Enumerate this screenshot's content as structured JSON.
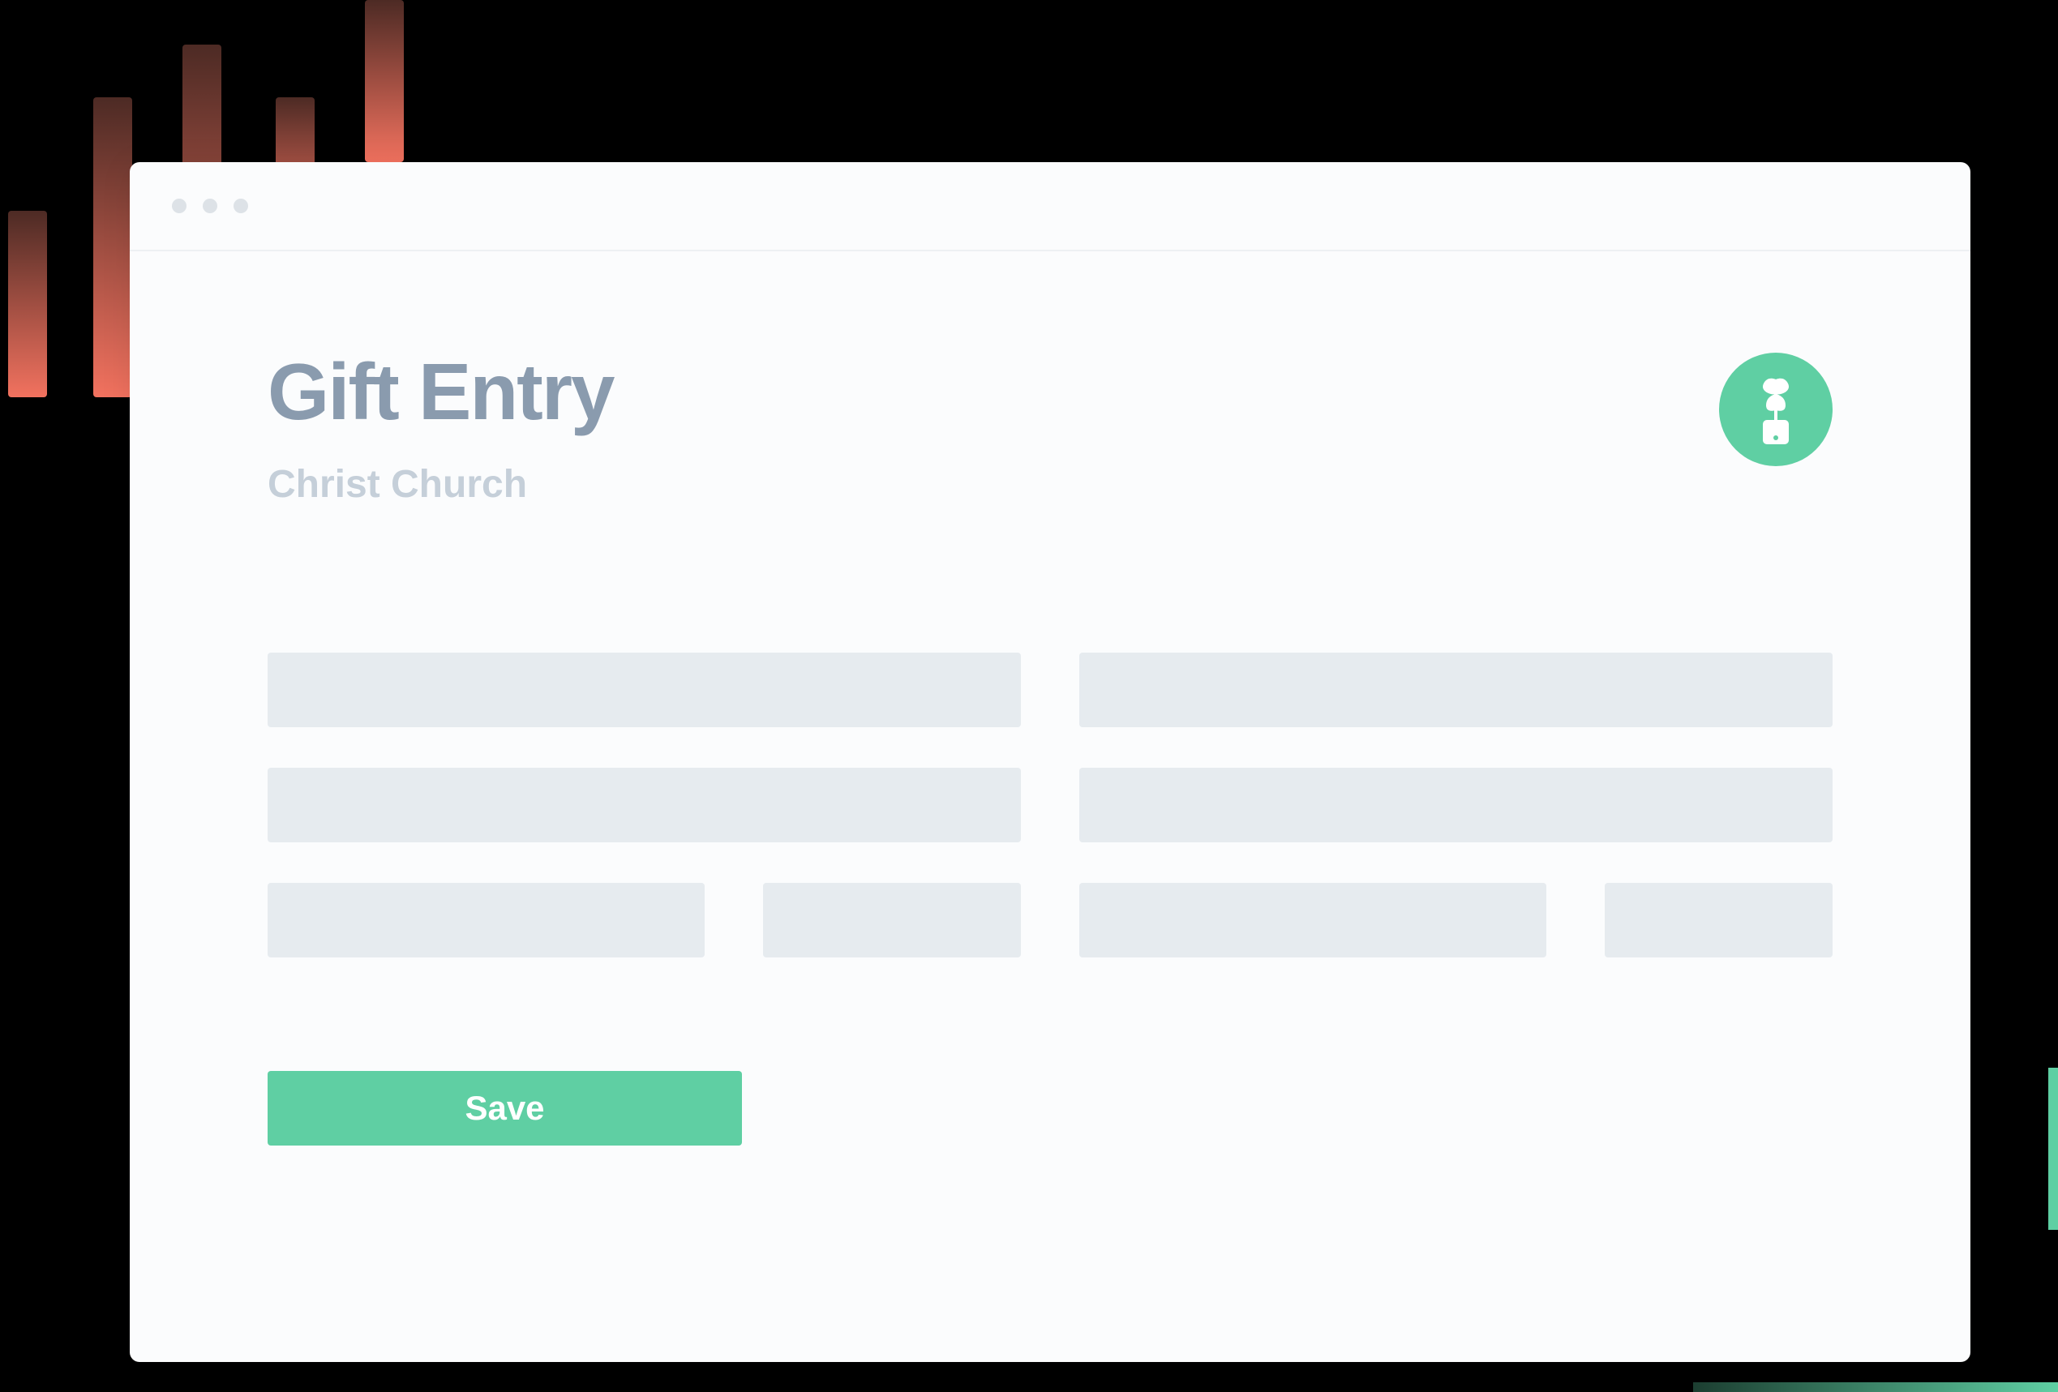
{
  "header": {
    "title": "Gift Entry",
    "subtitle": "Christ Church"
  },
  "actions": {
    "save_label": "Save"
  },
  "brand": {
    "icon_name": "plant-phone-icon",
    "accent_color": "#5FCFA3"
  },
  "decorative": {
    "bars_color": "#FF9080",
    "green_accent": "#5FCFA3"
  }
}
